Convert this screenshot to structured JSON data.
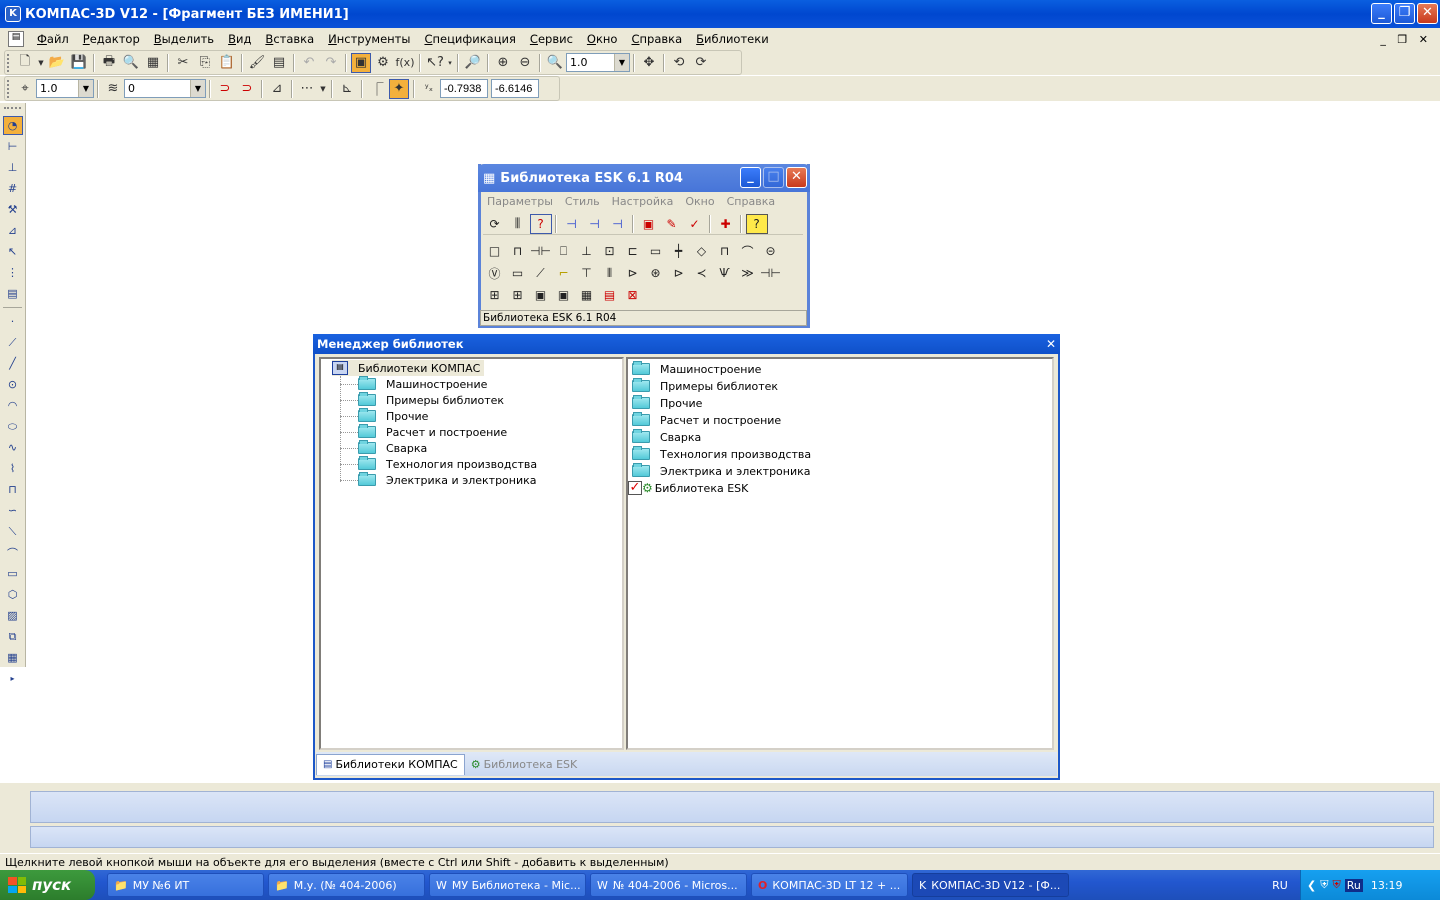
{
  "app": {
    "title": "КОМПАС-3D V12 - [Фрагмент БЕЗ ИМЕНИ1]",
    "icon": "kompas-logo-icon"
  },
  "menu": [
    "Файл",
    "Редактор",
    "Выделить",
    "Вид",
    "Вставка",
    "Инструменты",
    "Спецификация",
    "Сервис",
    "Окно",
    "Справка",
    "Библиотеки"
  ],
  "toolbar1": {
    "zoom_value": "1.0"
  },
  "toolbar2": {
    "step_value": "1.0",
    "layer_value": "0",
    "coord_x": "-0.7938",
    "coord_y": "-6.6146"
  },
  "esk_window": {
    "title": "Библиотека ESK 6.1 R04",
    "menu": [
      "Параметры",
      "Стиль",
      "Настройка",
      "Окно",
      "Справка"
    ],
    "status": "Библиотека ESK 6.1 R04"
  },
  "library_manager": {
    "title": "Менеджер библиотек",
    "tree_root": "Библиотеки КОМПАС",
    "tree_items": [
      "Машиностроение",
      "Примеры библиотек",
      "Прочие",
      "Расчет и построение",
      "Сварка",
      "Технология производства",
      "Электрика и электроника"
    ],
    "list_items": [
      "Машиностроение",
      "Примеры библиотек",
      "Прочие",
      "Расчет и построение",
      "Сварка",
      "Технология производства",
      "Электрика и электроника"
    ],
    "list_special": "Библиотека ESK",
    "tabs": [
      "Библиотеки КОМПАС",
      "Библиотека ESK"
    ]
  },
  "status_text": "Щелкните левой кнопкой мыши на объекте для его выделения (вместе с Ctrl или Shift - добавить к выделенным)",
  "taskbar": {
    "start": "пуск",
    "tasks": [
      "МУ №6 ИТ",
      "М.у. (№ 404-2006)",
      "МУ Библиотека - Mic...",
      "№ 404-2006 - Micros...",
      "КОМПАС-3D LT 12 + ...",
      "КОМПАС-3D V12 - [Ф..."
    ],
    "lang": "RU",
    "lang2": "Ru",
    "clock": "13:19"
  },
  "colors": {
    "titlebar": "#0a5fe0",
    "face": "#ece9d8",
    "taskbar": "#2257cf",
    "start": "#3d9a3d"
  }
}
